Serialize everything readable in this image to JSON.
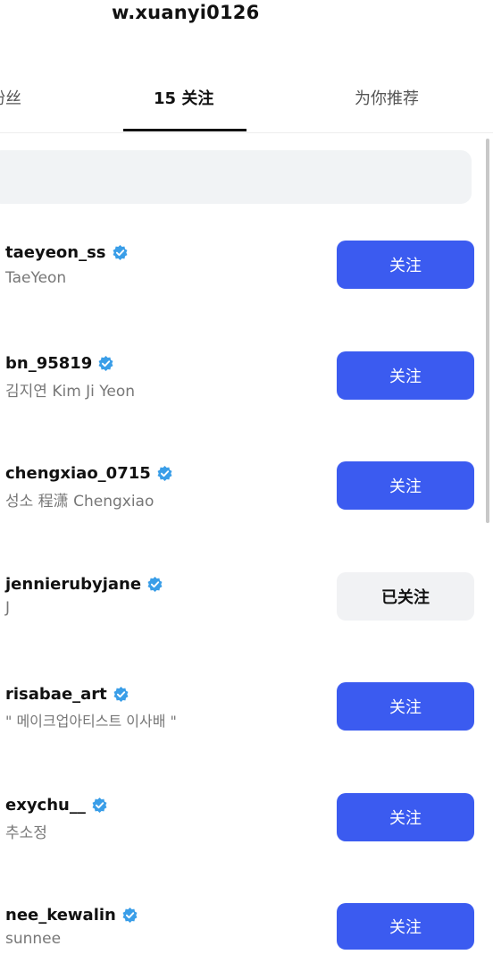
{
  "header": {
    "title": "w.xuanyi0126"
  },
  "tabs": [
    {
      "label": "粉丝"
    },
    {
      "label": "15 关注"
    },
    {
      "label": "为你推荐"
    }
  ],
  "search": {
    "placeholder": ""
  },
  "colors": {
    "follow_button": "#3b5bf0",
    "followed_button": "#f1f2f4",
    "verified_badge": "#3a9ee8"
  },
  "users": [
    {
      "username": "taeyeon_ss",
      "display_name": "TaeYeon",
      "button": "关注",
      "followed": false
    },
    {
      "username": "bn_95819",
      "display_name": "김지연 Kim Ji Yeon",
      "button": "关注",
      "followed": false
    },
    {
      "username": "chengxiao_0715",
      "display_name": "성소 程潇 Chengxiao",
      "button": "关注",
      "followed": false
    },
    {
      "username": "jennierubyjane",
      "display_name": "J",
      "button": "已关注",
      "followed": true
    },
    {
      "username": "risabae_art",
      "display_name": "\" 메이크업아티스트 이사배 \"",
      "button": "关注",
      "followed": false
    },
    {
      "username": "exychu__",
      "display_name": "추소정",
      "button": "关注",
      "followed": false
    },
    {
      "username": "nee_kewalin",
      "display_name": "sunnee",
      "button": "关注",
      "followed": false
    }
  ]
}
